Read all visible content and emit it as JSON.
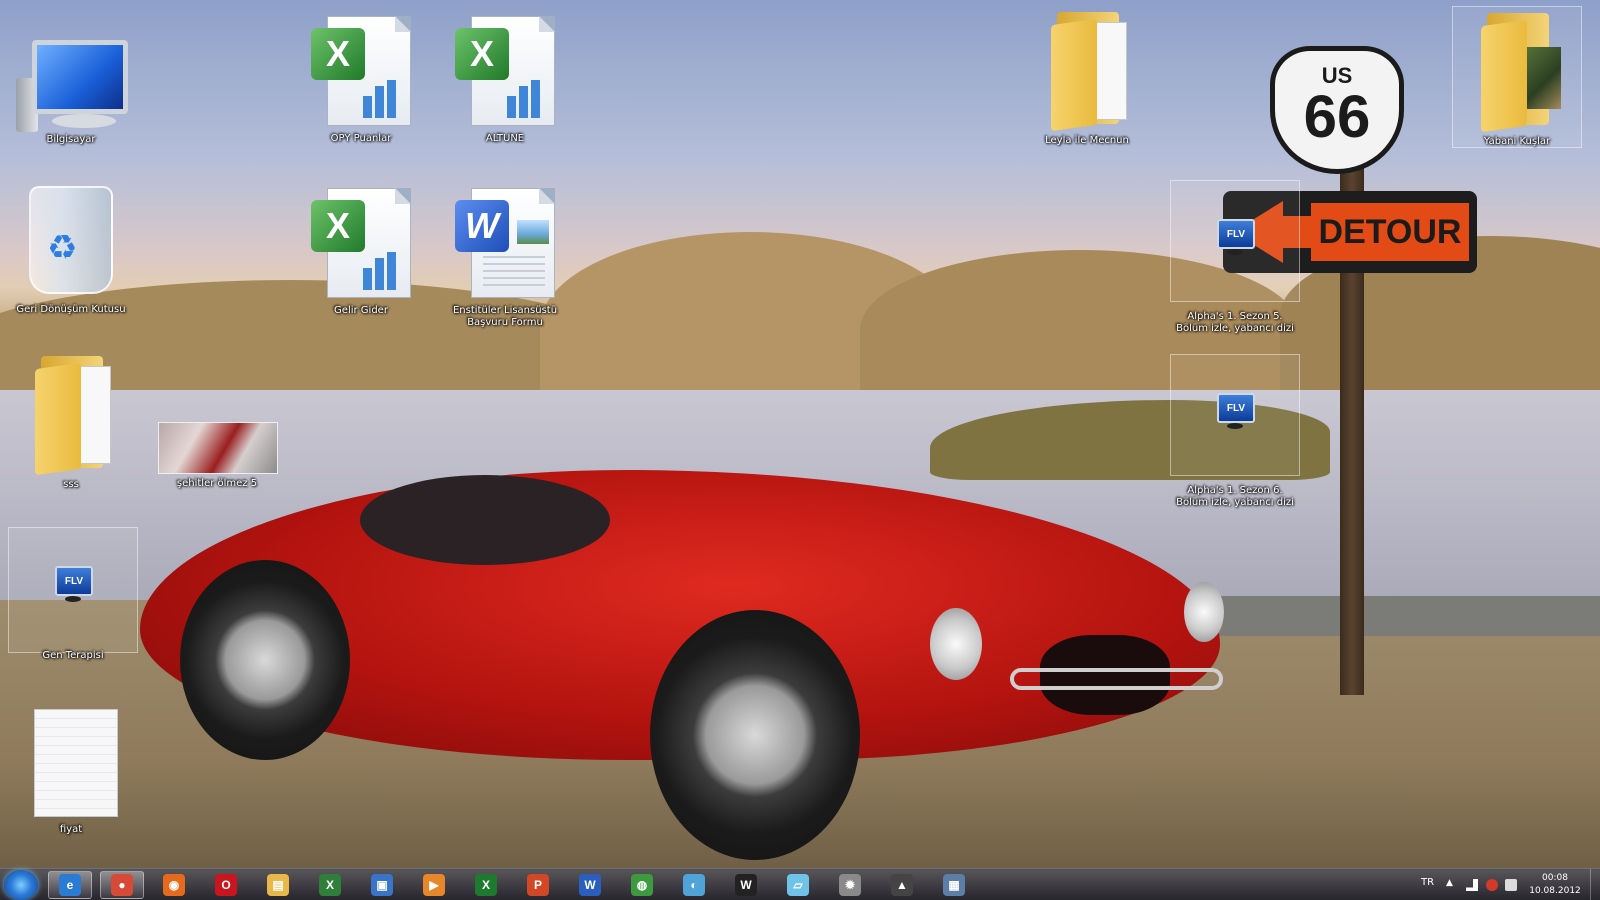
{
  "desktop": {
    "wallpaper": {
      "sign_shield_top": "US",
      "sign_shield_number": "66",
      "sign_detour": "DETOUR"
    },
    "icons": [
      {
        "label": "Bilgisayar"
      },
      {
        "label": "Geri Dönüşüm Kutusu"
      },
      {
        "label": "sss"
      },
      {
        "label": "Gen Terapisi"
      },
      {
        "label": "fiyat"
      },
      {
        "label": "OPY Puanlar"
      },
      {
        "label": "ALTUNE"
      },
      {
        "label": "Gelir Gider"
      },
      {
        "label": "Enstitüler Lisansüstü Başvuru Formu"
      },
      {
        "label": "şehitler ölmez 5"
      },
      {
        "label": "Leyla ile Mecnun"
      },
      {
        "label": "Yabani Kuşlar"
      },
      {
        "label": "Alpha's 1. Sezon 5. Bölüm izle, yabancı dizi"
      },
      {
        "label": "Alpha's 1. Sezon 6. Bölüm izle, yabancı dizi"
      }
    ],
    "flv_badge": "FLV"
  },
  "taskbar": {
    "apps": [
      {
        "name": "internet-explorer",
        "glyph": "e",
        "color": "#2a7bd4"
      },
      {
        "name": "google-chrome",
        "glyph": "●",
        "color": "#d84a38"
      },
      {
        "name": "firefox",
        "glyph": "◉",
        "color": "#e66a1e"
      },
      {
        "name": "opera",
        "glyph": "O",
        "color": "#c9151e"
      },
      {
        "name": "windows-explorer",
        "glyph": "▤",
        "color": "#e8b84a"
      },
      {
        "name": "excel-small",
        "glyph": "X",
        "color": "#2f7f3b"
      },
      {
        "name": "monitor-app",
        "glyph": "▣",
        "color": "#3a74c9"
      },
      {
        "name": "media-player",
        "glyph": "▶",
        "color": "#e8862a"
      },
      {
        "name": "excel",
        "glyph": "X",
        "color": "#1e7a2e"
      },
      {
        "name": "powerpoint",
        "glyph": "P",
        "color": "#d24726"
      },
      {
        "name": "word",
        "glyph": "W",
        "color": "#2b5fbf"
      },
      {
        "name": "globe-app",
        "glyph": "◍",
        "color": "#3e9a3e"
      },
      {
        "name": "paint-app",
        "glyph": "◐",
        "color": "#4fa3d8"
      },
      {
        "name": "winamp",
        "glyph": "W",
        "color": "#222222"
      },
      {
        "name": "notes-app",
        "glyph": "▱",
        "color": "#6fc3e8"
      },
      {
        "name": "settings-app",
        "glyph": "✹",
        "color": "#8a8a8a"
      },
      {
        "name": "road-app",
        "glyph": "▲",
        "color": "#444444"
      },
      {
        "name": "printer-app",
        "glyph": "▦",
        "color": "#5d7ea6"
      }
    ],
    "tray": {
      "language": "TR",
      "show_hidden": "▲",
      "time": "00:08",
      "date": "10.08.2012"
    }
  }
}
